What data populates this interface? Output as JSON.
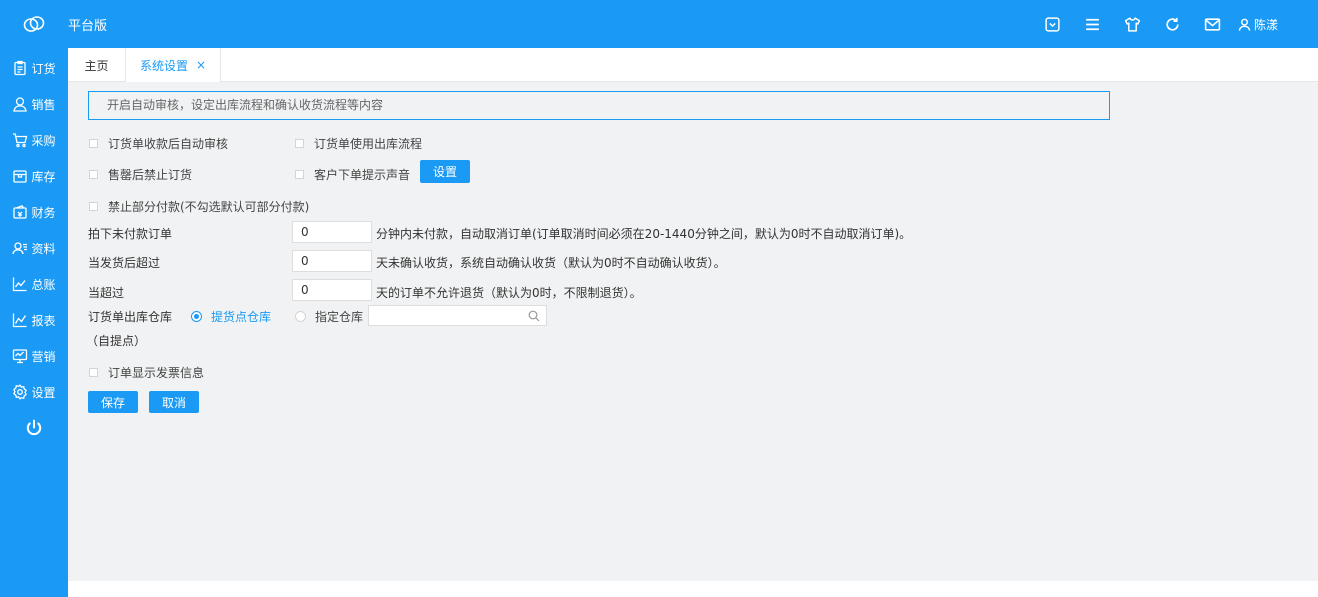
{
  "header": {
    "brand": "平台版",
    "user_name": "陈漾",
    "icons": [
      "dropdown-box-icon",
      "menu-icon",
      "shirt-icon",
      "refresh-icon",
      "mail-icon",
      "user-icon"
    ]
  },
  "sidebar": {
    "items": [
      {
        "label": "订货",
        "icon": "clipboard-icon"
      },
      {
        "label": "销售",
        "icon": "person-icon"
      },
      {
        "label": "采购",
        "icon": "cart-icon"
      },
      {
        "label": "库存",
        "icon": "box-icon"
      },
      {
        "label": "财务",
        "icon": "wallet-icon"
      },
      {
        "label": "资料",
        "icon": "contacts-icon"
      },
      {
        "label": "总账",
        "icon": "line-chart-icon"
      },
      {
        "label": "报表",
        "icon": "bar-chart-icon"
      },
      {
        "label": "营销",
        "icon": "monitor-icon"
      },
      {
        "label": "设置",
        "icon": "gear-icon"
      }
    ],
    "power_icon": "power-icon"
  },
  "tabs": {
    "home": "主页",
    "settings": "系统设置",
    "close": "×"
  },
  "form": {
    "notice": "开启自动审核，设定出库流程和确认收货流程等内容",
    "checkbox_auto_audit": "订货单收款后自动审核",
    "checkbox_outbound_flow": "订货单使用出库流程",
    "checkbox_sold_out": "售罄后禁止订货",
    "checkbox_sound": "客户下单提示声音",
    "sound_setting_button": "设置",
    "checkbox_partial_pay": "禁止部分付款(不勾选默认可部分付款)",
    "unpaid_label": "拍下未付款订单",
    "unpaid_value": "0",
    "unpaid_hint": "分钟内未付款，自动取消订单(订单取消时间必须在20-1440分钟之间，默认为0时不自动取消订单)。",
    "shipped_label": "当发货后超过",
    "shipped_value": "0",
    "shipped_hint": "天未确认收货，系统自动确认收货（默认为0时不自动确认收货）。",
    "return_label": "当超过",
    "return_value": "0",
    "return_hint": "天的订单不允许退货（默认为0时，不限制退货）。",
    "warehouse_label": "订货单出库仓库",
    "warehouse_sub": "（自提点）",
    "radio_pickup": "提货点仓库",
    "radio_assign": "指定仓库",
    "warehouse_selected": "提货点仓库",
    "checkbox_invoice": "订单显示发票信息",
    "save_button": "保存",
    "cancel_button": "取消"
  },
  "colors": {
    "accent": "#1a9af5",
    "background": "#f1f2f3"
  }
}
